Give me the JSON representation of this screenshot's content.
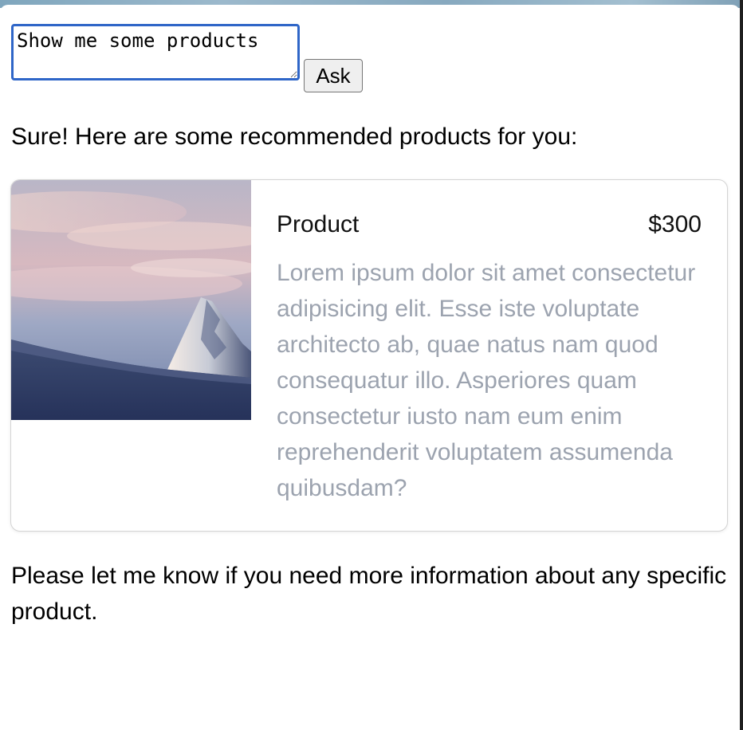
{
  "chat": {
    "prompt_value": "Show me some products",
    "ask_label": "Ask",
    "intro": "Sure! Here are some recommended products for you:",
    "outro": "Please let me know if you need more information about any specific product."
  },
  "product": {
    "name": "Product",
    "price": "$300",
    "description": "Lorem ipsum dolor sit amet consectetur adipisicing elit. Esse iste voluptate architecto ab, quae natus nam quod consequatur illo. Asperiores quam consectetur iusto nam eum enim reprehenderit voluptatem assumenda quibusdam?",
    "image": "snowy-mountain-peak-at-dusk"
  },
  "colors": {
    "input_focus_border": "#2f66c8",
    "description_text": "#9ca3af",
    "card_border": "#d4d4d4",
    "button_background": "#efefef"
  }
}
